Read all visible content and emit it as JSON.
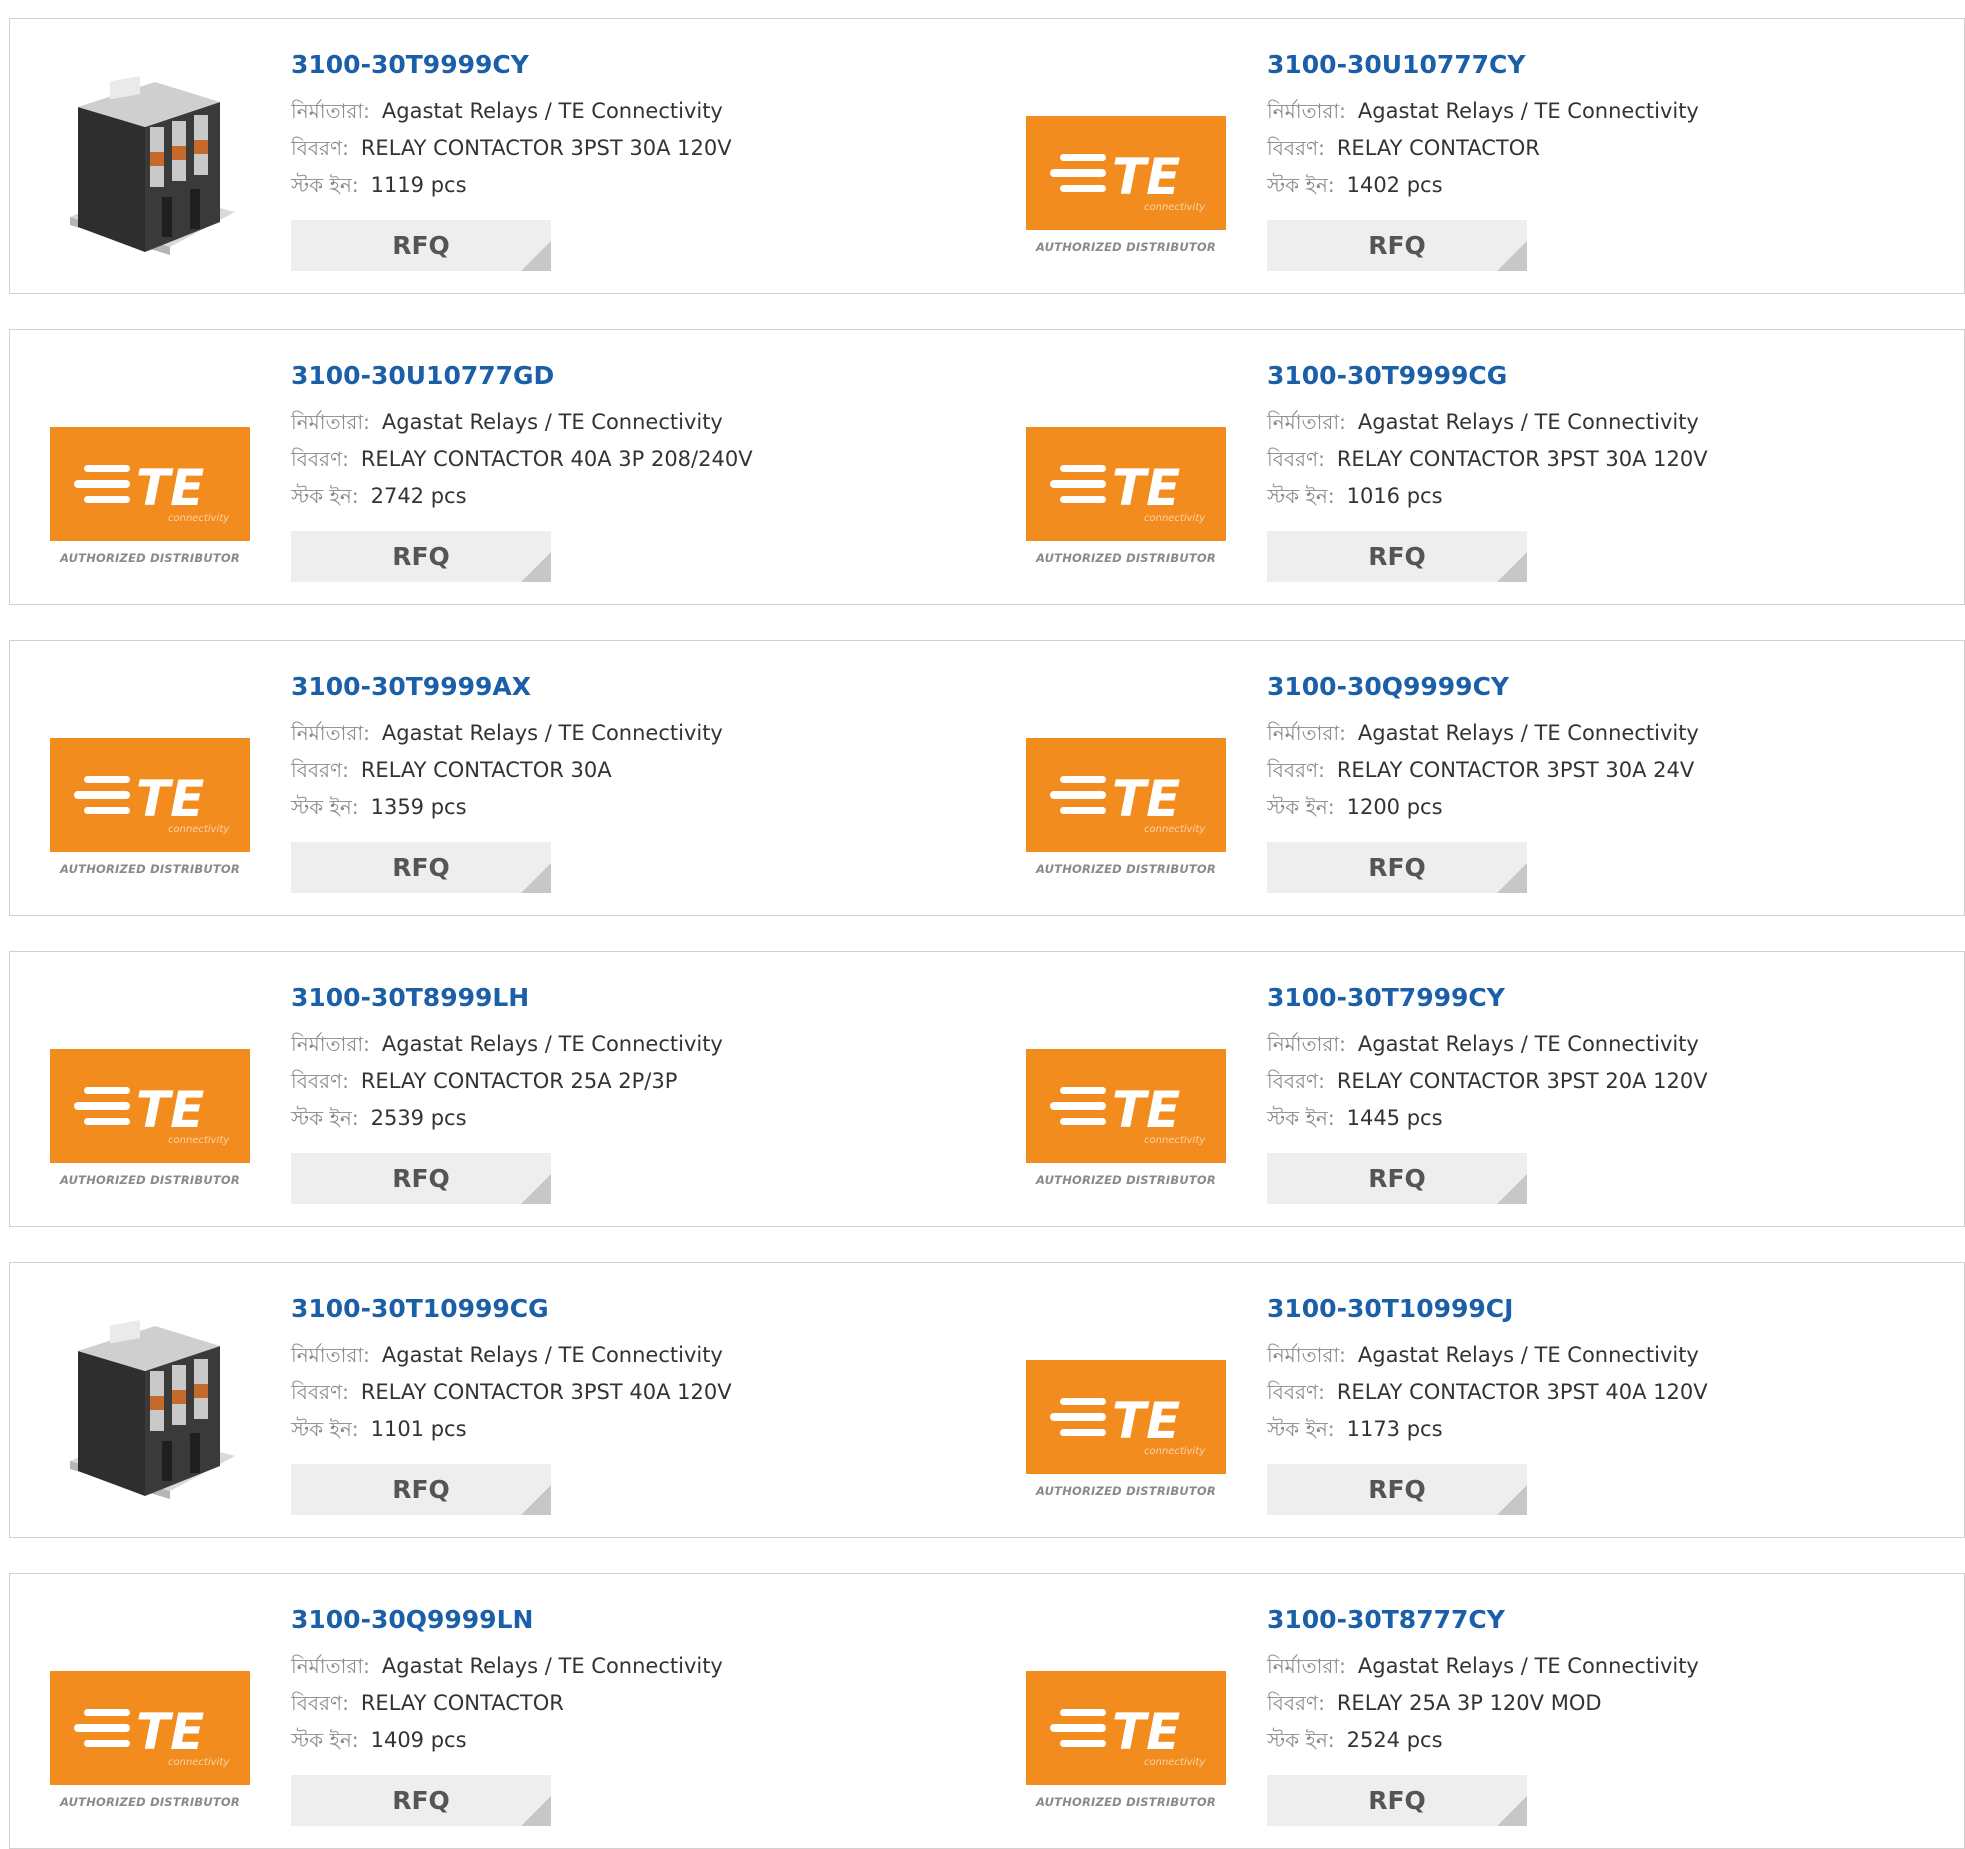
{
  "labels": {
    "manufacturer": "নির্মাতারা:",
    "description": "বিবরণ:",
    "stock": "স্টক ইন:"
  },
  "rfq_label": "RFQ",
  "logo": {
    "brand_text": "TE",
    "brand_sub": "connectivity",
    "distributor_text": "AUTHORIZED DISTRIBUTOR"
  },
  "colors": {
    "part_number": "#1a5fa8",
    "te_orange": "#f28c1e",
    "label_gray": "#8a8a8a",
    "rfq_bg": "#eeeeee"
  },
  "products": [
    {
      "part": "3100-30T9999CY",
      "manufacturer": "Agastat Relays / TE Connectivity",
      "description": "RELAY CONTACTOR 3PST 30A 120V",
      "stock": "1119 pcs",
      "image": "relay-photo"
    },
    {
      "part": "3100-30U10777CY",
      "manufacturer": "Agastat Relays / TE Connectivity",
      "description": "RELAY CONTACTOR",
      "stock": "1402 pcs",
      "image": "te-logo"
    },
    {
      "part": "3100-30U10777GD",
      "manufacturer": "Agastat Relays / TE Connectivity",
      "description": "RELAY CONTACTOR 40A 3P 208/240V",
      "stock": "2742 pcs",
      "image": "te-logo"
    },
    {
      "part": "3100-30T9999CG",
      "manufacturer": "Agastat Relays / TE Connectivity",
      "description": "RELAY CONTACTOR 3PST 30A 120V",
      "stock": "1016 pcs",
      "image": "te-logo"
    },
    {
      "part": "3100-30T9999AX",
      "manufacturer": "Agastat Relays / TE Connectivity",
      "description": "RELAY CONTACTOR 30A",
      "stock": "1359 pcs",
      "image": "te-logo"
    },
    {
      "part": "3100-30Q9999CY",
      "manufacturer": "Agastat Relays / TE Connectivity",
      "description": "RELAY CONTACTOR 3PST 30A 24V",
      "stock": "1200 pcs",
      "image": "te-logo"
    },
    {
      "part": "3100-30T8999LH",
      "manufacturer": "Agastat Relays / TE Connectivity",
      "description": "RELAY CONTACTOR 25A 2P/3P",
      "stock": "2539 pcs",
      "image": "te-logo"
    },
    {
      "part": "3100-30T7999CY",
      "manufacturer": "Agastat Relays / TE Connectivity",
      "description": "RELAY CONTACTOR 3PST 20A 120V",
      "stock": "1445 pcs",
      "image": "te-logo"
    },
    {
      "part": "3100-30T10999CG",
      "manufacturer": "Agastat Relays / TE Connectivity",
      "description": "RELAY CONTACTOR 3PST 40A 120V",
      "stock": "1101 pcs",
      "image": "relay-photo"
    },
    {
      "part": "3100-30T10999CJ",
      "manufacturer": "Agastat Relays / TE Connectivity",
      "description": "RELAY CONTACTOR 3PST 40A 120V",
      "stock": "1173 pcs",
      "image": "te-logo"
    },
    {
      "part": "3100-30Q9999LN",
      "manufacturer": "Agastat Relays / TE Connectivity",
      "description": "RELAY CONTACTOR",
      "stock": "1409 pcs",
      "image": "te-logo"
    },
    {
      "part": "3100-30T8777CY",
      "manufacturer": "Agastat Relays / TE Connectivity",
      "description": "RELAY 25A 3P 120V MOD",
      "stock": "2524 pcs",
      "image": "te-logo"
    }
  ]
}
